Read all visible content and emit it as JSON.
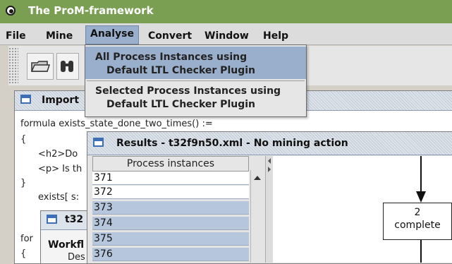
{
  "app": {
    "title": "The ProM-framework"
  },
  "menu": {
    "file": "File",
    "mine": "Mine",
    "analyse": "Analyse",
    "convert": "Convert",
    "window": "Window",
    "help": "Help"
  },
  "analyse_menu": {
    "items": [
      {
        "line1": "All Process Instances using",
        "line2": "Default LTL Checker Plugin",
        "highlighted": true
      },
      {
        "line1": "Selected Process Instances using",
        "line2": "Default LTL Checker Plugin",
        "highlighted": false
      }
    ]
  },
  "toolbar": {
    "open_icon": "folder-icon",
    "search_icon": "binoculars-icon"
  },
  "import_window": {
    "title": "Import",
    "lines": [
      "formula exists_state_done_two_times() :=",
      "{",
      "<h2>Do",
      "<p> Is th",
      "}",
      "exists[ s:",
      "for",
      "{"
    ]
  },
  "t32_window": {
    "title": "t32",
    "body_label": "Workfl",
    "body_sub": "Des"
  },
  "results_window": {
    "title": "Results - t32f9n50.xml - No mining action",
    "list_header": "Process instances",
    "instances": [
      "371",
      "372",
      "373",
      "374",
      "375",
      "376"
    ],
    "selected": [
      "373",
      "374",
      "375",
      "376"
    ]
  },
  "diagram": {
    "node_label": "2",
    "node_sub": "complete"
  },
  "colors": {
    "titlebar": "#7a9e52",
    "menu_highlight": "#9aafcc",
    "selection": "#b6c6dc"
  }
}
